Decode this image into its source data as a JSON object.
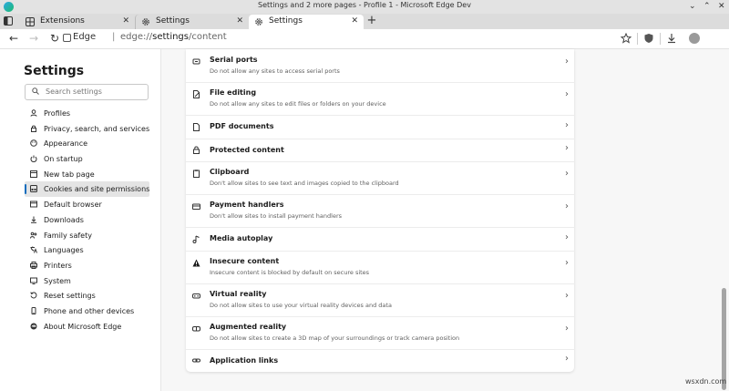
{
  "window": {
    "title": "Settings and 2 more pages - Profile 1 - Microsoft  Edge Dev",
    "minimize": "⌄",
    "maximize": "⌃",
    "close": "✕"
  },
  "tabs": [
    {
      "label": "Extensions",
      "close": "✕"
    },
    {
      "label": "Settings",
      "close": "✕"
    },
    {
      "label": "Settings",
      "close": "✕"
    }
  ],
  "newtab": "+",
  "address": {
    "brand": "Edge",
    "separator": "|",
    "url_prefix": "edge://",
    "url_main": "settings",
    "url_suffix": "/content"
  },
  "toolbar": {
    "back": "←",
    "forward": "→",
    "refresh": "↻"
  },
  "sidebar": {
    "heading": "Settings",
    "search_placeholder": "Search settings",
    "items": [
      {
        "label": "Profiles",
        "icon": "person-icon"
      },
      {
        "label": "Privacy, search, and services",
        "icon": "lock-icon"
      },
      {
        "label": "Appearance",
        "icon": "appearance-icon"
      },
      {
        "label": "On startup",
        "icon": "power-icon"
      },
      {
        "label": "New tab page",
        "icon": "newtab-icon"
      },
      {
        "label": "Cookies and site permissions",
        "icon": "cookies-icon",
        "selected": true
      },
      {
        "label": "Default browser",
        "icon": "browser-icon"
      },
      {
        "label": "Downloads",
        "icon": "download-icon"
      },
      {
        "label": "Family safety",
        "icon": "family-icon"
      },
      {
        "label": "Languages",
        "icon": "languages-icon"
      },
      {
        "label": "Printers",
        "icon": "printer-icon"
      },
      {
        "label": "System",
        "icon": "system-icon"
      },
      {
        "label": "Reset settings",
        "icon": "reset-icon"
      },
      {
        "label": "Phone and other devices",
        "icon": "phone-icon"
      },
      {
        "label": "About Microsoft Edge",
        "icon": "edge-icon"
      }
    ]
  },
  "permissions": [
    {
      "title": "Serial ports",
      "desc": "Do not allow any sites to access serial ports",
      "icon": "serial-port-icon"
    },
    {
      "title": "File editing",
      "desc": "Do not allow any sites to edit files or folders on your device",
      "icon": "file-edit-icon"
    },
    {
      "title": "PDF documents",
      "desc": "",
      "icon": "pdf-icon"
    },
    {
      "title": "Protected content",
      "desc": "",
      "icon": "lock-icon"
    },
    {
      "title": "Clipboard",
      "desc": "Don't allow sites to see text and images copied to the clipboard",
      "icon": "clipboard-icon"
    },
    {
      "title": "Payment handlers",
      "desc": "Don't allow sites to install payment handlers",
      "icon": "payment-icon"
    },
    {
      "title": "Media autoplay",
      "desc": "",
      "icon": "media-icon"
    },
    {
      "title": "Insecure content",
      "desc": "Insecure content is blocked by default on secure sites",
      "icon": "warning-icon"
    },
    {
      "title": "Virtual reality",
      "desc": "Do not allow sites to use your virtual reality devices and data",
      "icon": "vr-icon"
    },
    {
      "title": "Augmented reality",
      "desc": "Do not allow sites to create a 3D map of your surroundings or track camera position",
      "icon": "ar-icon"
    },
    {
      "title": "Application links",
      "desc": "",
      "icon": "link-icon"
    }
  ],
  "chevron": "›",
  "watermark": "wsxdn.com"
}
